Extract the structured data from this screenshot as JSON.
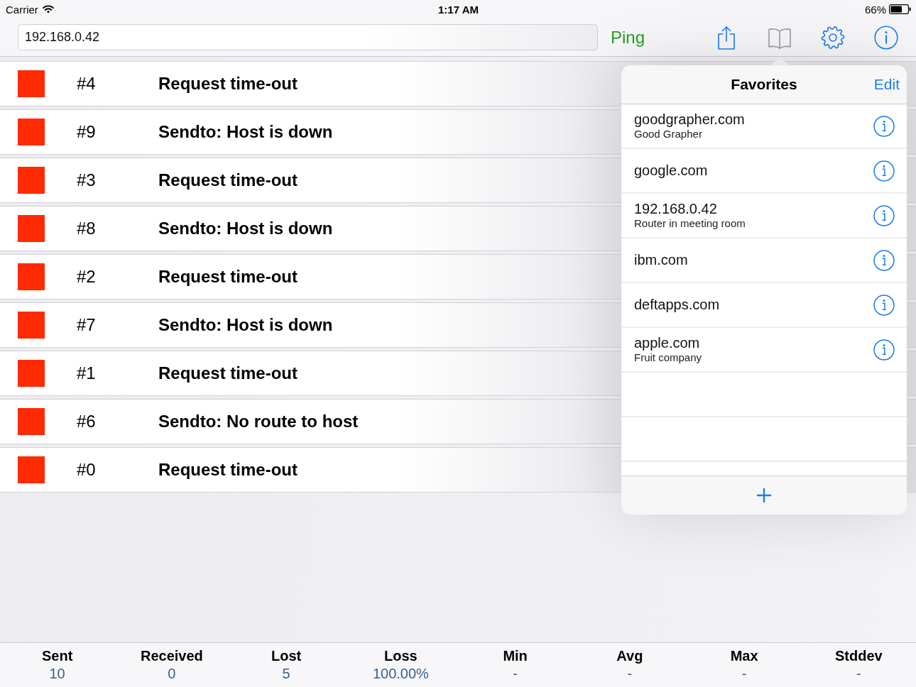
{
  "status_bar": {
    "carrier": "Carrier",
    "time": "1:17 AM",
    "battery": "66%"
  },
  "toolbar": {
    "address": {
      "value": "192.168.0.42"
    },
    "ping_button": "Ping",
    "buttons": [
      {
        "kind": "share",
        "selected": false
      },
      {
        "kind": "bookmarks",
        "selected": true
      },
      {
        "kind": "settings",
        "selected": false
      },
      {
        "kind": "info",
        "selected": false
      }
    ]
  },
  "results": [
    {
      "number": "#4",
      "message": "Request time-out",
      "lost": true
    },
    {
      "number": "#9",
      "message": "Sendto: Host is down",
      "lost": true
    },
    {
      "number": "#3",
      "message": "Request time-out",
      "lost": true
    },
    {
      "number": "#8",
      "message": "Sendto: Host is down",
      "lost": true
    },
    {
      "number": "#2",
      "message": "Request time-out",
      "lost": true
    },
    {
      "number": "#7",
      "message": "Sendto: Host is down",
      "lost": true
    },
    {
      "number": "#1",
      "message": "Request time-out",
      "lost": true
    },
    {
      "number": "#6",
      "message": "Sendto: No route to host",
      "lost": true
    },
    {
      "number": "#0",
      "message": "Request time-out",
      "lost": true
    }
  ],
  "favorites": {
    "title": "Favorites",
    "edit_button": "Edit",
    "items": [
      {
        "name": "goodgrapher.com",
        "note": "Good Grapher"
      },
      {
        "name": "google.com"
      },
      {
        "name": "192.168.0.42",
        "note": "Router in meeting room"
      },
      {
        "name": "ibm.com"
      },
      {
        "name": "deftapps.com"
      },
      {
        "name": "apple.com",
        "note": "Fruit company"
      }
    ]
  },
  "statistics": [
    {
      "label": "Sent",
      "value": "10"
    },
    {
      "label": "Received",
      "value": "0"
    },
    {
      "label": "Lost",
      "value": "5"
    },
    {
      "label": "Loss",
      "value": "100.00%"
    },
    {
      "label": "Min",
      "value": "-"
    },
    {
      "label": "Avg",
      "value": "-"
    },
    {
      "label": "Max",
      "value": "-"
    },
    {
      "label": "Stddev",
      "value": "-"
    }
  ]
}
